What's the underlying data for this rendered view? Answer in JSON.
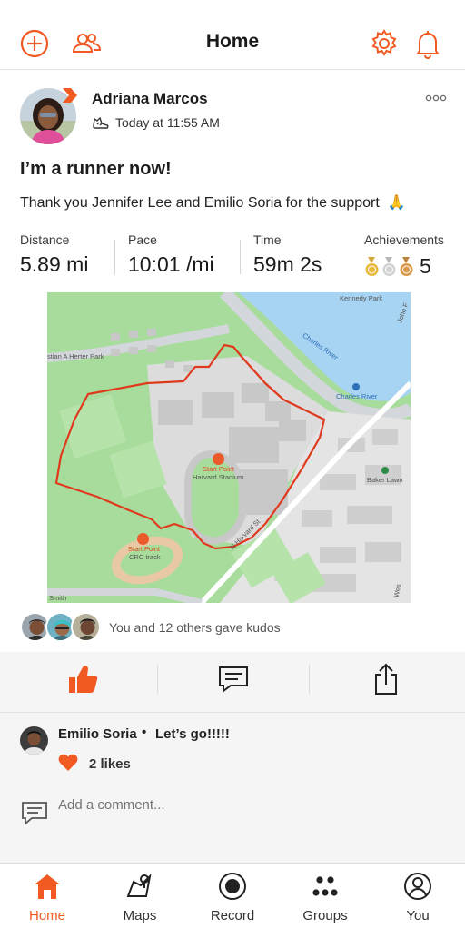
{
  "header": {
    "title": "Home",
    "accent": "#f15a22"
  },
  "activity": {
    "athlete_name": "Adriana Marcos",
    "timestamp": "Today at 11:55 AM",
    "title": "I’m a runner now!",
    "description": "Thank you Jennifer Lee and Emilio Soria for the support",
    "description_emoji": "🙏",
    "stats": [
      {
        "label": "Distance",
        "value": "5.89 mi"
      },
      {
        "label": "Pace",
        "value": "10:01 /mi"
      },
      {
        "label": "Time",
        "value": "59m 2s"
      }
    ],
    "achievements": {
      "label": "Achievements",
      "value": "5"
    }
  },
  "map": {
    "labels": {
      "kennedy_park": "Kennedy Park",
      "herter_park": "stian A Herter Park",
      "charles_river": "Charles River",
      "charles_river_station": "Charles River",
      "start_point_1": "Start Point",
      "harvard_stadium": "Harvard Stadium",
      "baker_lawn": "Baker Lawn",
      "start_point_2": "Start Point",
      "crc_track": "CRC track",
      "n_harvard_st": "N Harvard St",
      "smith": "Smith",
      "john_f": "John F",
      "western": "Wes"
    },
    "route_color": "#e03a1e"
  },
  "kudos": {
    "text": "You and 12 others gave kudos"
  },
  "comment": {
    "author": "Emilio Soria",
    "separator": "•",
    "text": "Let’s go!!!!!",
    "likes": "2 likes",
    "add_placeholder": "Add a comment..."
  },
  "nav": {
    "items": [
      {
        "label": "Home"
      },
      {
        "label": "Maps"
      },
      {
        "label": "Record"
      },
      {
        "label": "Groups"
      },
      {
        "label": "You"
      }
    ]
  }
}
